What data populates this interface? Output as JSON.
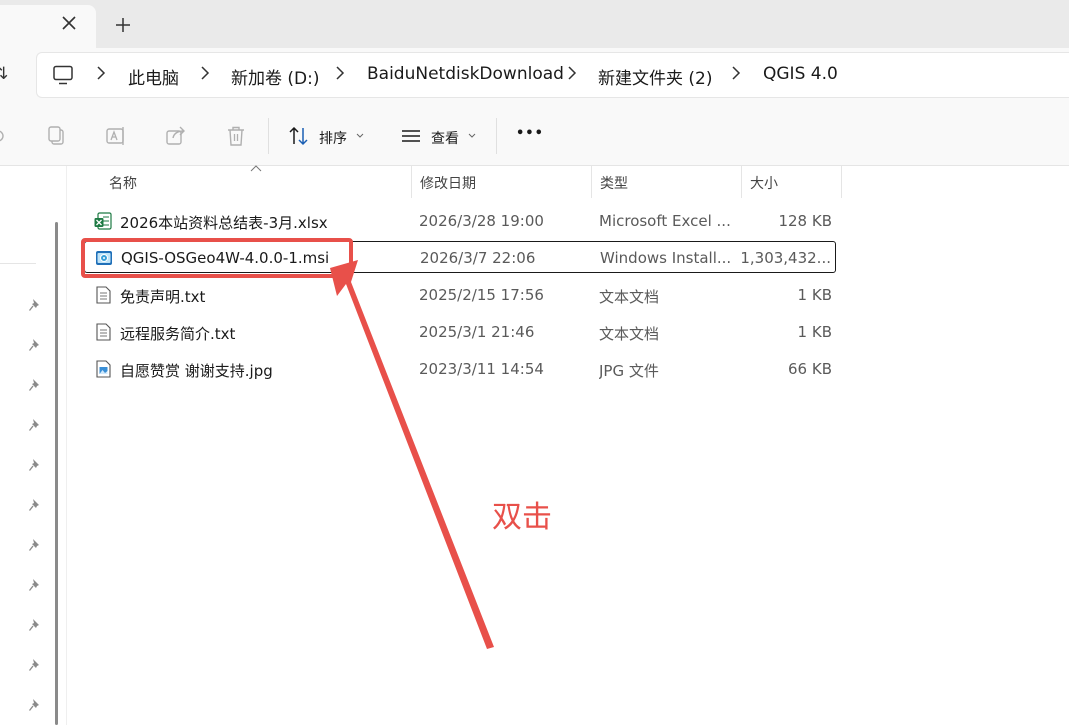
{
  "tabs": {
    "close_label": "✕",
    "new_tab_label": "+"
  },
  "address": {
    "left_glyph": "⇅",
    "crumbs": [
      "此电脑",
      "新加卷 (D:)",
      "BaiduNetdiskDownload",
      "新建文件夹 (2)",
      "QGIS 4.0"
    ]
  },
  "toolbar": {
    "sort_label": "排序",
    "view_label": "查看",
    "more_label": "•••",
    "icons": [
      "copy-icon",
      "rename-icon",
      "share-icon",
      "delete-icon",
      "sort-icon",
      "view-icon"
    ]
  },
  "list": {
    "columns": [
      "名称",
      "修改日期",
      "类型",
      "大小"
    ],
    "rows": [
      {
        "name": "2026本站资料总结表-3月.xlsx",
        "date": "2026/3/28 19:00",
        "type": "Microsoft Excel ...",
        "size": "128 KB",
        "icon": "excel-icon"
      },
      {
        "name": "QGIS-OSGeo4W-4.0.0-1.msi",
        "date": "2026/3/7 22:06",
        "type": "Windows Install...",
        "size": "1,303,432...",
        "icon": "msi-installer-icon",
        "selected": true
      },
      {
        "name": "免责声明.txt",
        "date": "2025/2/15 17:56",
        "type": "文本文档",
        "size": "1 KB",
        "icon": "text-file-icon"
      },
      {
        "name": "远程服务简介.txt",
        "date": "2025/3/1 21:46",
        "type": "文本文档",
        "size": "1 KB",
        "icon": "text-file-icon"
      },
      {
        "name": "自愿赞赏 谢谢支持.jpg",
        "date": "2023/3/11 14:54",
        "type": "JPG 文件",
        "size": "66 KB",
        "icon": "image-file-icon"
      }
    ]
  },
  "annotation": {
    "text": "双击",
    "color": "#e8504a"
  },
  "colors": {
    "tab_bg": "#eaeaea",
    "toolbar_bg": "#f9f9f9",
    "excel_green": "#1d7a43",
    "annotation_red": "#e8504a"
  }
}
